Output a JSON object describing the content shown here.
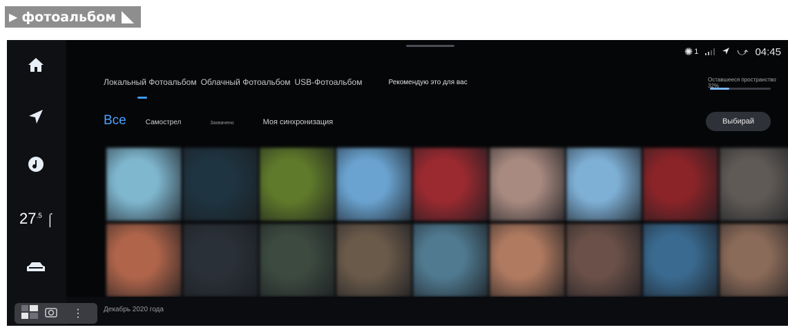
{
  "header": {
    "title": "фотоальбом"
  },
  "status_bar": {
    "fan_level": "1",
    "time": "04:45"
  },
  "tabs": [
    {
      "label": "Локальный Фотоальбом"
    },
    {
      "label": "Облачный Фотоальбом"
    },
    {
      "label": "USB-Фотоальбом"
    },
    {
      "label": "Рекомендую это для вас"
    }
  ],
  "storage": {
    "label": "Оставшееся пространство 32%",
    "remaining_fraction": 0.32
  },
  "filters": [
    {
      "label": "Все"
    },
    {
      "label": "Самострел"
    },
    {
      "label": "Захвачено"
    },
    {
      "label": "Моя синхронизация"
    }
  ],
  "select_button": "Выбирай",
  "sidebar": {
    "temperature": "27",
    "temperature_decimal": ".5"
  },
  "date_section": "Декабрь 2020 года",
  "colors": {
    "accent": "#3e9bf5",
    "screen_bg": "#050608",
    "header_bg": "#8e8e8e"
  },
  "photos": [
    "#7fb7cf",
    "#1e3440",
    "#5f7a2a",
    "#6aa3d0",
    "#9a2a30",
    "#a88a80",
    "#7eb0d6",
    "#8a2428",
    "#5f5a56",
    "#b0654a",
    "#2a3038",
    "#3c4a40",
    "#6a5a4a",
    "#507a90",
    "#b07a60",
    "#6a5048",
    "#3a6a90",
    "#8a6a58"
  ]
}
